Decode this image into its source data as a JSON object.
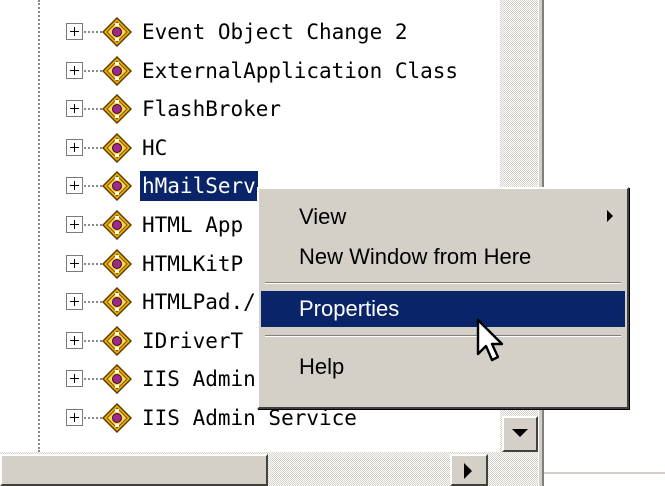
{
  "tree": {
    "nodes": [
      {
        "label": "Event Object Change 2",
        "selected": false
      },
      {
        "label": "ExternalApplication Class",
        "selected": false
      },
      {
        "label": "FlashBroker",
        "selected": false
      },
      {
        "label": "HC",
        "selected": false
      },
      {
        "label": "hMailServ",
        "selected": true
      },
      {
        "label": "HTML App",
        "selected": false
      },
      {
        "label": "HTMLKitP",
        "selected": false
      },
      {
        "label": "HTMLPad./",
        "selected": false
      },
      {
        "label": "IDriverT",
        "selected": false
      },
      {
        "label": "IIS Admin",
        "selected": false
      },
      {
        "label": "IIS Admin Service",
        "selected": false
      }
    ]
  },
  "context_menu": {
    "view": "View",
    "new_window": "New Window from Here",
    "properties": "Properties",
    "help": "Help",
    "highlighted_item": "Properties"
  },
  "colors": {
    "selection": "#0a246a",
    "chrome": "#d4d0c8",
    "icon_fill": "#f0b400"
  },
  "icons": [
    "plus-expander-icon",
    "com-object-icon",
    "scroll-down-arrow-icon",
    "scroll-right-arrow-icon",
    "submenu-arrow-icon",
    "mouse-pointer-icon"
  ]
}
